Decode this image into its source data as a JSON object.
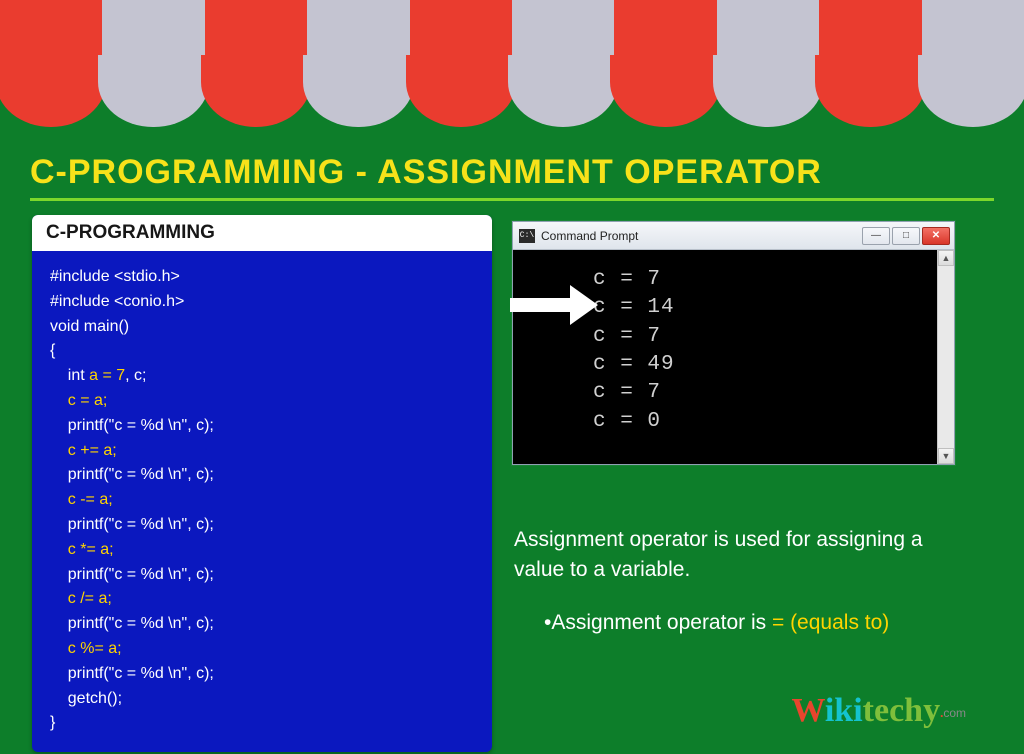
{
  "heading": "C-PROGRAMMING - ASSIGNMENT OPERATOR",
  "code_card": {
    "title": "C-PROGRAMMING",
    "lines": [
      {
        "segments": [
          {
            "t": "#include <stdio.h>",
            "hl": false
          }
        ]
      },
      {
        "segments": [
          {
            "t": "#include <conio.h>",
            "hl": false
          }
        ]
      },
      {
        "segments": [
          {
            "t": "void main()",
            "hl": false
          }
        ]
      },
      {
        "segments": [
          {
            "t": "{",
            "hl": false
          }
        ]
      },
      {
        "segments": [
          {
            "t": "    int ",
            "hl": false
          },
          {
            "t": "a = 7",
            "hl": true
          },
          {
            "t": ", c;",
            "hl": false
          }
        ]
      },
      {
        "segments": [
          {
            "t": "    ",
            "hl": false
          },
          {
            "t": "c = a;",
            "hl": true
          }
        ]
      },
      {
        "segments": [
          {
            "t": "    printf(\"c = %d \\n\", c);",
            "hl": false
          }
        ]
      },
      {
        "segments": [
          {
            "t": "    ",
            "hl": false
          },
          {
            "t": "c += a;",
            "hl": true
          }
        ]
      },
      {
        "segments": [
          {
            "t": "    printf(\"c = %d \\n\", c);",
            "hl": false
          }
        ]
      },
      {
        "segments": [
          {
            "t": "    ",
            "hl": false
          },
          {
            "t": "c -= a;",
            "hl": true
          }
        ]
      },
      {
        "segments": [
          {
            "t": "    printf(\"c = %d \\n\", c);",
            "hl": false
          }
        ]
      },
      {
        "segments": [
          {
            "t": "    ",
            "hl": false
          },
          {
            "t": "c *= a;",
            "hl": true
          }
        ]
      },
      {
        "segments": [
          {
            "t": "    printf(\"c = %d \\n\", c);",
            "hl": false
          }
        ]
      },
      {
        "segments": [
          {
            "t": "    ",
            "hl": false
          },
          {
            "t": "c /= a;",
            "hl": true
          }
        ]
      },
      {
        "segments": [
          {
            "t": "    printf(\"c = %d \\n\", c);",
            "hl": false
          }
        ]
      },
      {
        "segments": [
          {
            "t": "    ",
            "hl": false
          },
          {
            "t": "c %= a;",
            "hl": true
          }
        ]
      },
      {
        "segments": [
          {
            "t": "    printf(\"c = %d \\n\", c);",
            "hl": false
          }
        ]
      },
      {
        "segments": [
          {
            "t": "    getch();",
            "hl": false
          }
        ]
      },
      {
        "segments": [
          {
            "t": "}",
            "hl": false
          }
        ]
      }
    ]
  },
  "cmd": {
    "icon_label": "C:\\",
    "title": "Command Prompt",
    "output": [
      "c = 7",
      "c = 14",
      "c = 7",
      "c = 49",
      "c = 7",
      "c = 0"
    ]
  },
  "explain": {
    "line1": "Assignment operator is used for assigning a value to a variable.",
    "bullet_prefix": "•Assignment operator is ",
    "equals": "= (equals to)"
  },
  "logo": {
    "w": "W",
    "iki": "iki",
    "techy": "techy",
    "dot": ".",
    "com": "com"
  }
}
